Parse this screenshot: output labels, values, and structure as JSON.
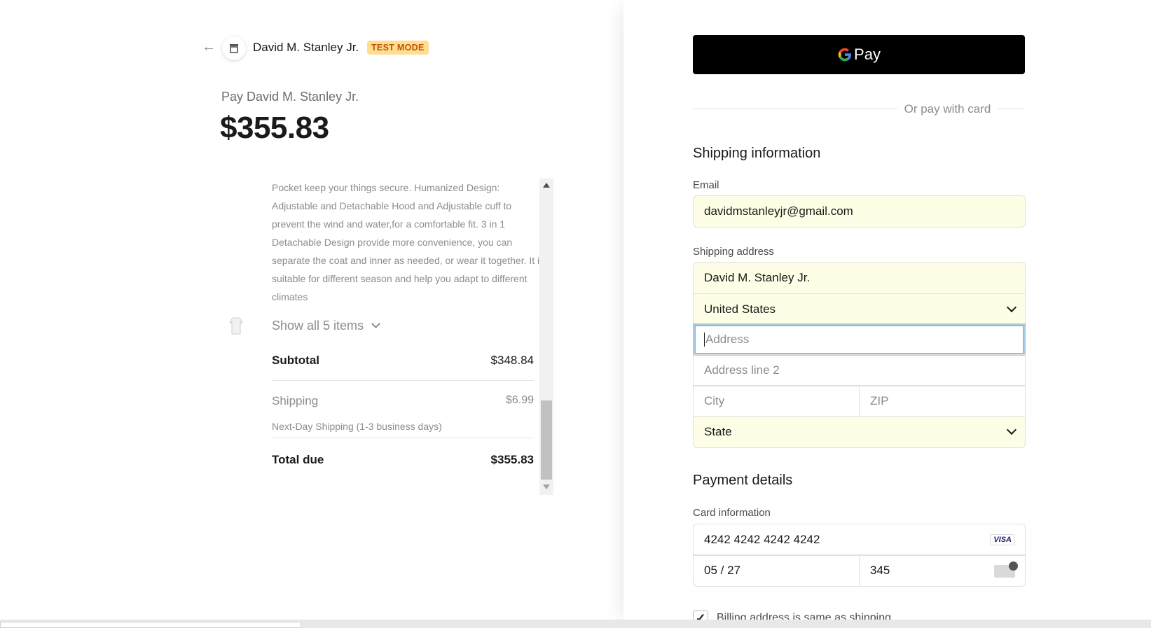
{
  "merchant": {
    "name": "David M. Stanley Jr.",
    "badge": "TEST MODE",
    "pay_label": "Pay David M. Stanley Jr.",
    "amount": "$355.83"
  },
  "summary": {
    "description": "Pocket keep your things secure. Humanized Design: Adjustable and Detachable Hood and Adjustable cuff to prevent the wind and water,for a comfortable fit. 3 in 1 Detachable Design provide more convenience, you can separate the coat and inner as needed, or wear it together. It is suitable for different season and help you adapt to different climates",
    "show_all": "Show all 5 items",
    "subtotal_label": "Subtotal",
    "subtotal_value": "$348.84",
    "shipping_label": "Shipping",
    "shipping_value": "$6.99",
    "shipping_detail": "Next-Day Shipping (1-3 business days)",
    "total_label": "Total due",
    "total_value": "$355.83"
  },
  "payment": {
    "gpay_label": "Pay",
    "or_text": "Or pay with card",
    "shipping_title": "Shipping information",
    "email_label": "Email",
    "email_value": "davidmstanleyjr@gmail.com",
    "address_label": "Shipping address",
    "name_value": "David M. Stanley Jr.",
    "country_value": "United States",
    "address_placeholder": "Address",
    "address2_placeholder": "Address line 2",
    "city_placeholder": "City",
    "zip_placeholder": "ZIP",
    "state_value": "State",
    "payment_title": "Payment details",
    "card_label": "Card information",
    "card_number": "4242 4242 4242 4242",
    "card_brand": "VISA",
    "expiry": "05 / 27",
    "cvc": "345",
    "billing_same": "Billing address is same as shipping"
  },
  "colors": {
    "badge_bg": "#ffde92",
    "badge_text": "#bb5504",
    "autofill_bg": "#fefde5",
    "focus_ring": "#7cb5e0"
  }
}
